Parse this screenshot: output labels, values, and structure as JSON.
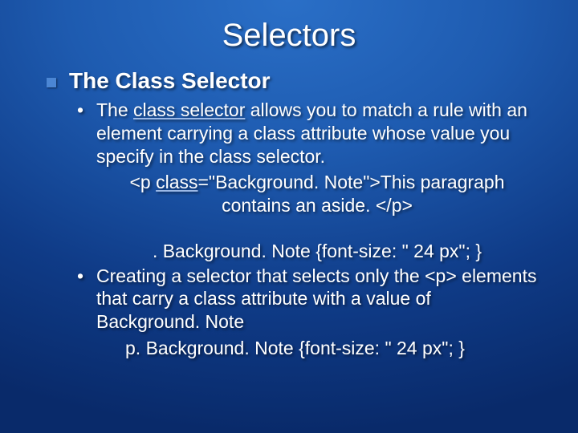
{
  "title": "Selectors",
  "heading": "The Class Selector",
  "bullet1_a": "The ",
  "bullet1_u": "class selector",
  "bullet1_b": " allows you to match a rule with an element carrying a class attribute whose value you specify in the class selector.",
  "code1_a": "<p ",
  "code1_u": "class",
  "code1_b": "=\"Background. Note\">This paragraph contains an aside. </p>",
  "rule1": ". Background. Note {font-size: \" 24 px\"; }",
  "bullet2": "Creating a selector that selects only the <p> elements that carry a class attribute with a value of Background. Note",
  "rule2": "p. Background. Note {font-size: \" 24 px\"; }"
}
